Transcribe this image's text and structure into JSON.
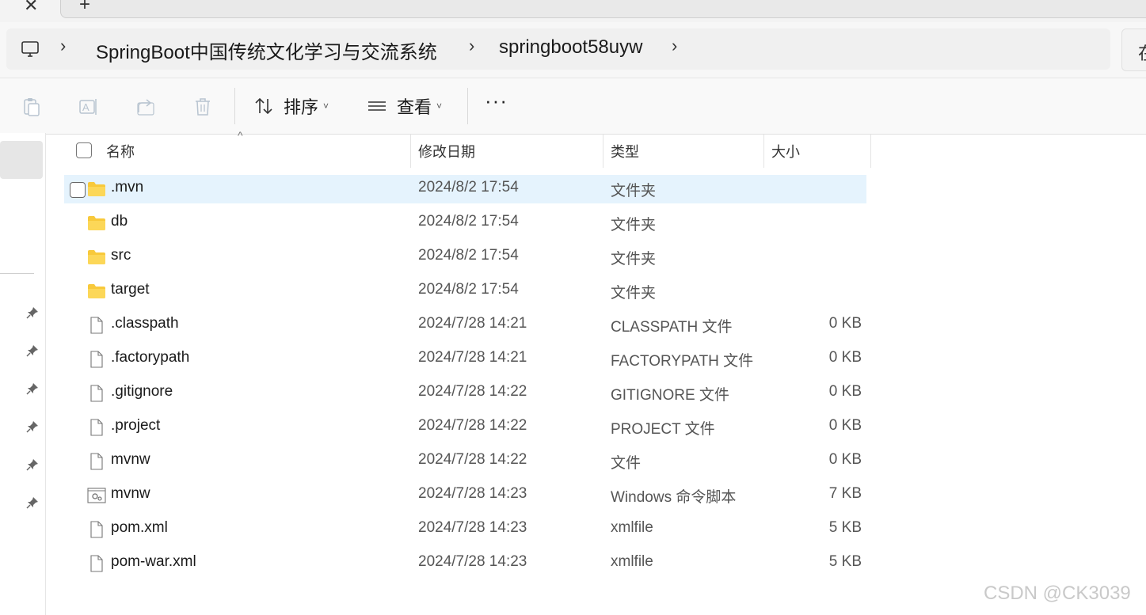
{
  "tabs": {
    "close_glyph": "✕",
    "new_glyph": "+"
  },
  "breadcrumb": {
    "items": [
      "SpringBoot中国传统文化学习与交流系统",
      "springboot58uyw"
    ],
    "separator": "›"
  },
  "search": {
    "text": "在"
  },
  "toolbar": {
    "sort_label": "排序",
    "view_label": "查看",
    "more_label": "···"
  },
  "columns": {
    "name": "名称",
    "date": "修改日期",
    "type": "类型",
    "size": "大小"
  },
  "files": [
    {
      "name": ".mvn",
      "date": "2024/8/2 17:54",
      "type": "文件夹",
      "size": "",
      "icon": "folder-icon"
    },
    {
      "name": "db",
      "date": "2024/8/2 17:54",
      "type": "文件夹",
      "size": "",
      "icon": "folder-icon"
    },
    {
      "name": "src",
      "date": "2024/8/2 17:54",
      "type": "文件夹",
      "size": "",
      "icon": "folder-icon"
    },
    {
      "name": "target",
      "date": "2024/8/2 17:54",
      "type": "文件夹",
      "size": "",
      "icon": "folder-icon"
    },
    {
      "name": ".classpath",
      "date": "2024/7/28 14:21",
      "type": "CLASSPATH 文件",
      "size": "0 KB",
      "icon": "file-icon"
    },
    {
      "name": ".factorypath",
      "date": "2024/7/28 14:21",
      "type": "FACTORYPATH 文件",
      "size": "0 KB",
      "icon": "file-icon"
    },
    {
      "name": ".gitignore",
      "date": "2024/7/28 14:22",
      "type": "GITIGNORE 文件",
      "size": "0 KB",
      "icon": "file-icon"
    },
    {
      "name": ".project",
      "date": "2024/7/28 14:22",
      "type": "PROJECT 文件",
      "size": "0 KB",
      "icon": "file-icon"
    },
    {
      "name": "mvnw",
      "date": "2024/7/28 14:22",
      "type": "文件",
      "size": "0 KB",
      "icon": "file-icon"
    },
    {
      "name": "mvnw",
      "date": "2024/7/28 14:23",
      "type": "Windows 命令脚本",
      "size": "7 KB",
      "icon": "script-file-icon"
    },
    {
      "name": "pom.xml",
      "date": "2024/7/28 14:23",
      "type": "xmlfile",
      "size": "5 KB",
      "icon": "file-icon"
    },
    {
      "name": "pom-war.xml",
      "date": "2024/7/28 14:23",
      "type": "xmlfile",
      "size": "5 KB",
      "icon": "file-icon"
    }
  ],
  "watermark": "CSDN @CK3039",
  "colors": {
    "selected_row": "#e5f3fd",
    "folder": "#f8c93b"
  }
}
